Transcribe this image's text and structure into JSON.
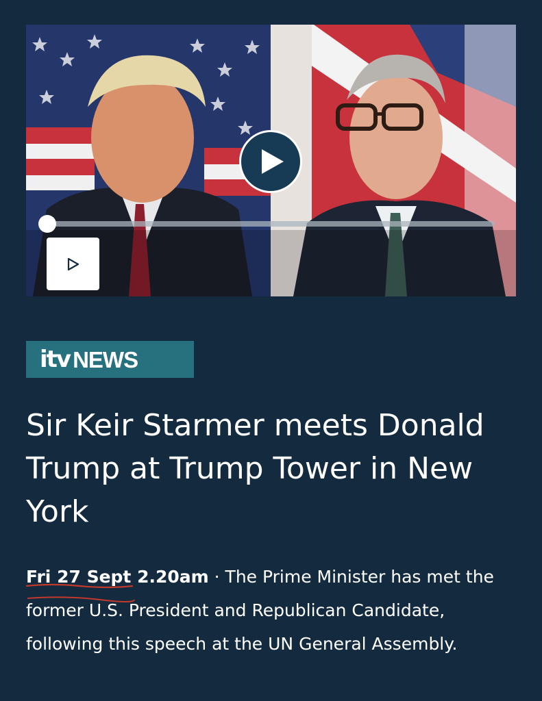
{
  "video": {
    "thumbnail": "Donald Trump and Keir Starmer in front of US and UK flags",
    "play_icon": "play-icon",
    "small_play_icon": "play-outline-icon",
    "progress": 0
  },
  "brand": {
    "logo_text": "itv",
    "news_label": "NEWS",
    "color": "#27707d"
  },
  "article": {
    "headline": "Sir Keir Starmer meets Donald Trump at Trump Tower in New York",
    "date": "Fri 27 Sept 2.20am",
    "separator": "·",
    "summary": "The Prime Minister has met the former U.S. President and Republican Candidate, following this speech at the UN General Assembly."
  },
  "colors": {
    "background": "#142b3f",
    "annotation": "#c0392b"
  }
}
